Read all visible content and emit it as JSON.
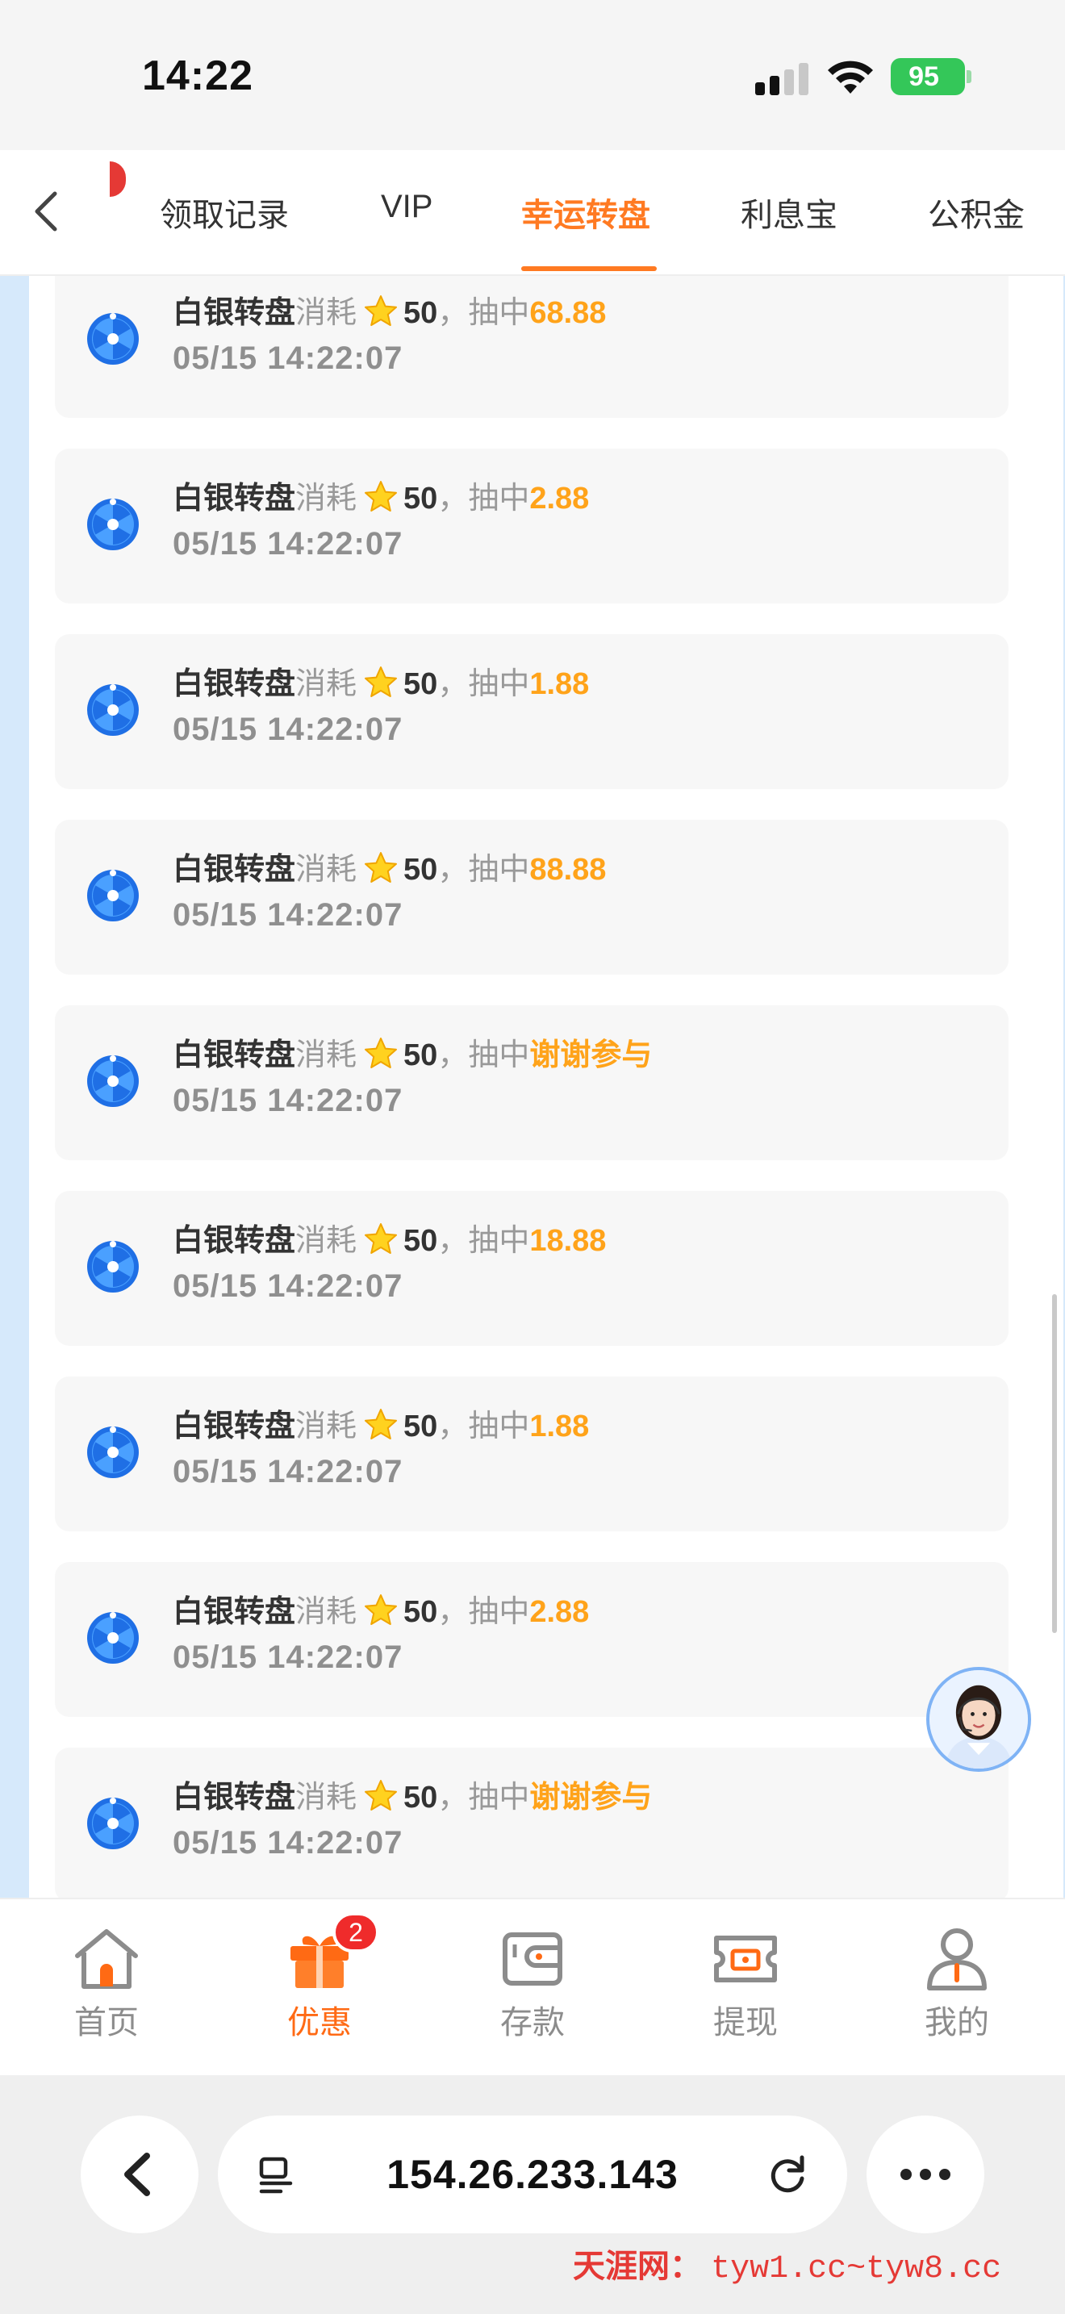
{
  "status_bar": {
    "time": "14:22",
    "battery": "95"
  },
  "tabs": [
    {
      "label": "领取记录",
      "active": false
    },
    {
      "label": "VIP",
      "active": false
    },
    {
      "label": "幸运转盘",
      "active": true
    },
    {
      "label": "利息宝",
      "active": false
    },
    {
      "label": "公积金",
      "active": false
    }
  ],
  "records": [
    {
      "wheel": "白银转盘",
      "consume": "消耗",
      "cost": "50",
      "sep": "，",
      "win_label": "抽中",
      "prize": "68.88",
      "time": "05/15 14:22:07"
    },
    {
      "wheel": "白银转盘",
      "consume": "消耗",
      "cost": "50",
      "sep": "，",
      "win_label": "抽中",
      "prize": "2.88",
      "time": "05/15 14:22:07"
    },
    {
      "wheel": "白银转盘",
      "consume": "消耗",
      "cost": "50",
      "sep": "，",
      "win_label": "抽中",
      "prize": "1.88",
      "time": "05/15 14:22:07"
    },
    {
      "wheel": "白银转盘",
      "consume": "消耗",
      "cost": "50",
      "sep": "，",
      "win_label": "抽中",
      "prize": "88.88",
      "time": "05/15 14:22:07"
    },
    {
      "wheel": "白银转盘",
      "consume": "消耗",
      "cost": "50",
      "sep": "，",
      "win_label": "抽中",
      "prize": "谢谢参与",
      "time": "05/15 14:22:07"
    },
    {
      "wheel": "白银转盘",
      "consume": "消耗",
      "cost": "50",
      "sep": "，",
      "win_label": "抽中",
      "prize": "18.88",
      "time": "05/15 14:22:07"
    },
    {
      "wheel": "白银转盘",
      "consume": "消耗",
      "cost": "50",
      "sep": "，",
      "win_label": "抽中",
      "prize": "1.88",
      "time": "05/15 14:22:07"
    },
    {
      "wheel": "白银转盘",
      "consume": "消耗",
      "cost": "50",
      "sep": "，",
      "win_label": "抽中",
      "prize": "2.88",
      "time": "05/15 14:22:07"
    },
    {
      "wheel": "白银转盘",
      "consume": "消耗",
      "cost": "50",
      "sep": "，",
      "win_label": "抽中",
      "prize": "谢谢参与",
      "time": "05/15 14:22:07"
    }
  ],
  "bottom_nav": [
    {
      "label": "首页",
      "icon": "home-icon",
      "active": false
    },
    {
      "label": "优惠",
      "icon": "gift-icon",
      "active": true,
      "badge": "2"
    },
    {
      "label": "存款",
      "icon": "wallet-icon",
      "active": false
    },
    {
      "label": "提现",
      "icon": "withdraw-icon",
      "active": false
    },
    {
      "label": "我的",
      "icon": "user-icon",
      "active": false
    }
  ],
  "browser": {
    "url": "154.26.233.143"
  },
  "watermark": {
    "brand": "天涯网：",
    "url": "tyw1.cc~tyw8.cc"
  },
  "colors": {
    "accent": "#ff7a22",
    "prize": "#ffa31a",
    "badge": "#ef2b2b",
    "content_bg": "#d6e9fb"
  }
}
